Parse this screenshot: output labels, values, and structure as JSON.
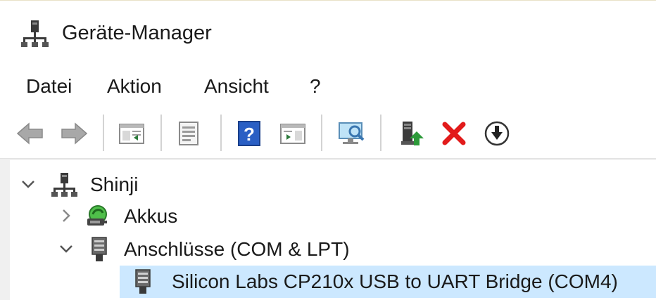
{
  "window": {
    "title": "Geräte-Manager",
    "title_icon": "device-manager-icon"
  },
  "menu": {
    "items": [
      "Datei",
      "Aktion",
      "Ansicht",
      "?"
    ]
  },
  "toolbar": {
    "buttons": [
      {
        "icon": "back-arrow-icon"
      },
      {
        "icon": "forward-arrow-icon"
      },
      {
        "icon": "show-hide-console-tree-icon"
      },
      {
        "icon": "properties-icon"
      },
      {
        "icon": "help-icon"
      },
      {
        "icon": "show-action-pane-icon"
      },
      {
        "icon": "scan-hardware-changes-icon"
      },
      {
        "icon": "update-driver-icon"
      },
      {
        "icon": "uninstall-device-icon"
      },
      {
        "icon": "disable-device-icon"
      }
    ],
    "colors": {
      "arrow_gray": "#9a9a9a",
      "help_blue": "#2a5fc4",
      "delete_red": "#e21b1b",
      "update_green": "#2d9a3a"
    }
  },
  "tree": {
    "root": {
      "label": "Shinji",
      "expanded": true
    },
    "nodes": [
      {
        "label": "Akkus",
        "expanded": false
      },
      {
        "label": "Anschlüsse (COM & LPT)",
        "expanded": true
      }
    ],
    "selected_item": {
      "label": "Silicon Labs CP210x USB to UART Bridge (COM4)"
    },
    "selection_color": "#cce8ff"
  }
}
